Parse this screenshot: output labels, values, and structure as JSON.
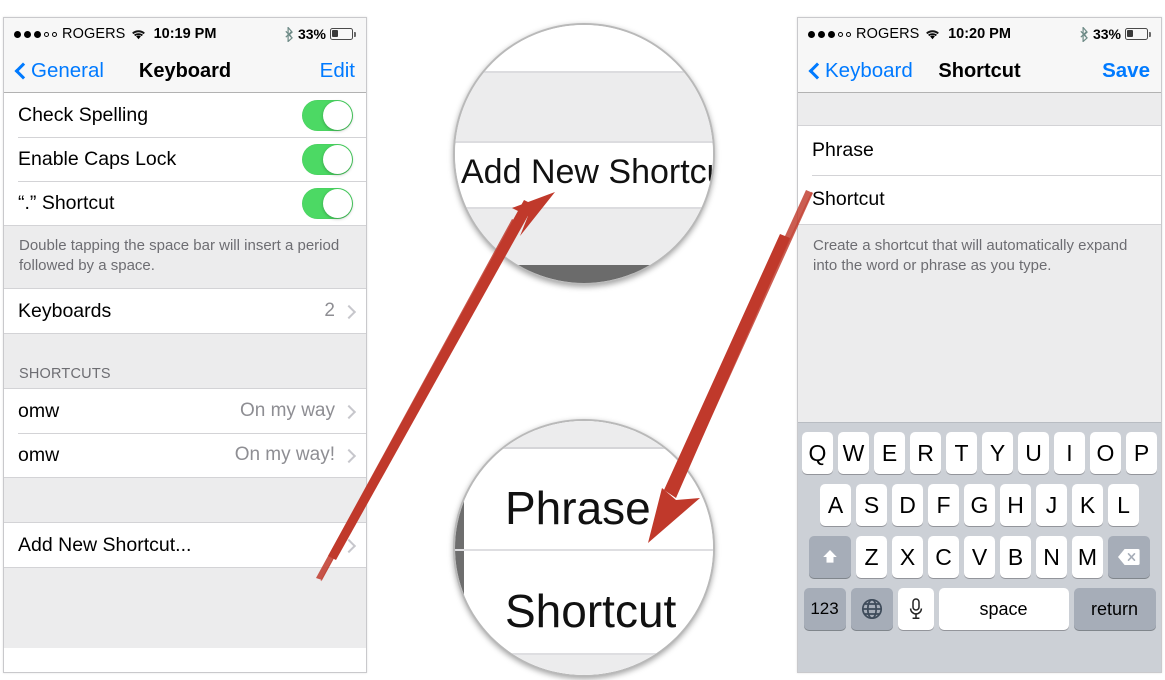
{
  "left_phone": {
    "status_bar": {
      "signal_filled_dots": 3,
      "signal_hollow_dots": 2,
      "carrier": "ROGERS",
      "wifi_icon": "wifi-icon",
      "time": "10:19 PM",
      "bluetooth_icon": "bluetooth-icon",
      "battery_percent": "33%",
      "battery_level": 33
    },
    "nav": {
      "back_label": "General",
      "title": "Keyboard",
      "action_label": "Edit"
    },
    "toggle_rows": [
      {
        "label": "Check Spelling",
        "value": "on"
      },
      {
        "label": "Enable Caps Lock",
        "value": "on"
      },
      {
        "label": "“.” Shortcut",
        "value": "on"
      }
    ],
    "footer_note": "Double tapping the space bar will insert a period followed by a space.",
    "keyboards_row": {
      "label": "Keyboards",
      "value": "2",
      "chevron": "chevron-right-icon"
    },
    "shortcuts_header": "SHORTCUTS",
    "shortcut_rows": [
      {
        "label": "omw",
        "value": "On my way",
        "chevron": "chevron-right-icon"
      },
      {
        "label": "omw",
        "value": "On my way!",
        "chevron": "chevron-right-icon"
      }
    ],
    "add_row": {
      "label": "Add New Shortcut...",
      "chevron": "chevron-right-icon"
    }
  },
  "right_phone": {
    "status_bar": {
      "signal_filled_dots": 3,
      "signal_hollow_dots": 2,
      "carrier": "ROGERS",
      "wifi_icon": "wifi-icon",
      "time": "10:20 PM",
      "bluetooth_icon": "bluetooth-icon",
      "battery_percent": "33%",
      "battery_level": 33
    },
    "nav": {
      "back_label": "Keyboard",
      "title": "Shortcut",
      "action_label": "Save"
    },
    "fields": [
      {
        "label": "Phrase",
        "placeholder": "Phrase",
        "value": ""
      },
      {
        "label": "Shortcut",
        "placeholder": "Shortcut",
        "value": ""
      }
    ],
    "footer_note": "Create a shortcut that will automatically  expand into the word or phrase  as you type.",
    "keyboard": {
      "row1": [
        "Q",
        "W",
        "E",
        "R",
        "T",
        "Y",
        "U",
        "I",
        "O",
        "P"
      ],
      "row2": [
        "A",
        "S",
        "D",
        "F",
        "G",
        "H",
        "J",
        "K",
        "L"
      ],
      "row3": [
        "Z",
        "X",
        "C",
        "V",
        "B",
        "N",
        "M"
      ],
      "shift_icon": "shift-up-arrow-icon",
      "delete_icon": "backspace-delete-icon",
      "numbers_label": "123",
      "globe_icon": "globe-emoji-icon",
      "mic_icon": "microphone-icon",
      "space_label": "space",
      "return_label": "return"
    }
  },
  "magnifiers": [
    {
      "name": "add-new-shortcut-magnifier",
      "text": "Add New Shortcut."
    },
    {
      "name": "phrase-shortcut-magnifier",
      "text_top": "Phrase",
      "text_bottom": "Shortcut"
    }
  ],
  "annotations": {
    "arrow_color": "#c0392b",
    "arrows": [
      {
        "name": "arrow-to-add-new-shortcut",
        "from": "add-new-shortcut-row",
        "to": "add-new-shortcut-magnifier"
      },
      {
        "name": "arrow-to-phrase-shortcut",
        "from": "shortcut-field",
        "to": "phrase-shortcut-magnifier"
      }
    ]
  },
  "colors": {
    "ios_blue": "#007aff",
    "toggle_green": "#4cd964",
    "group_bg": "#ececed",
    "keyboard_bg": "#ccd0d6",
    "key_dark": "#a6adb8",
    "secondary_text": "#8e8e93"
  }
}
